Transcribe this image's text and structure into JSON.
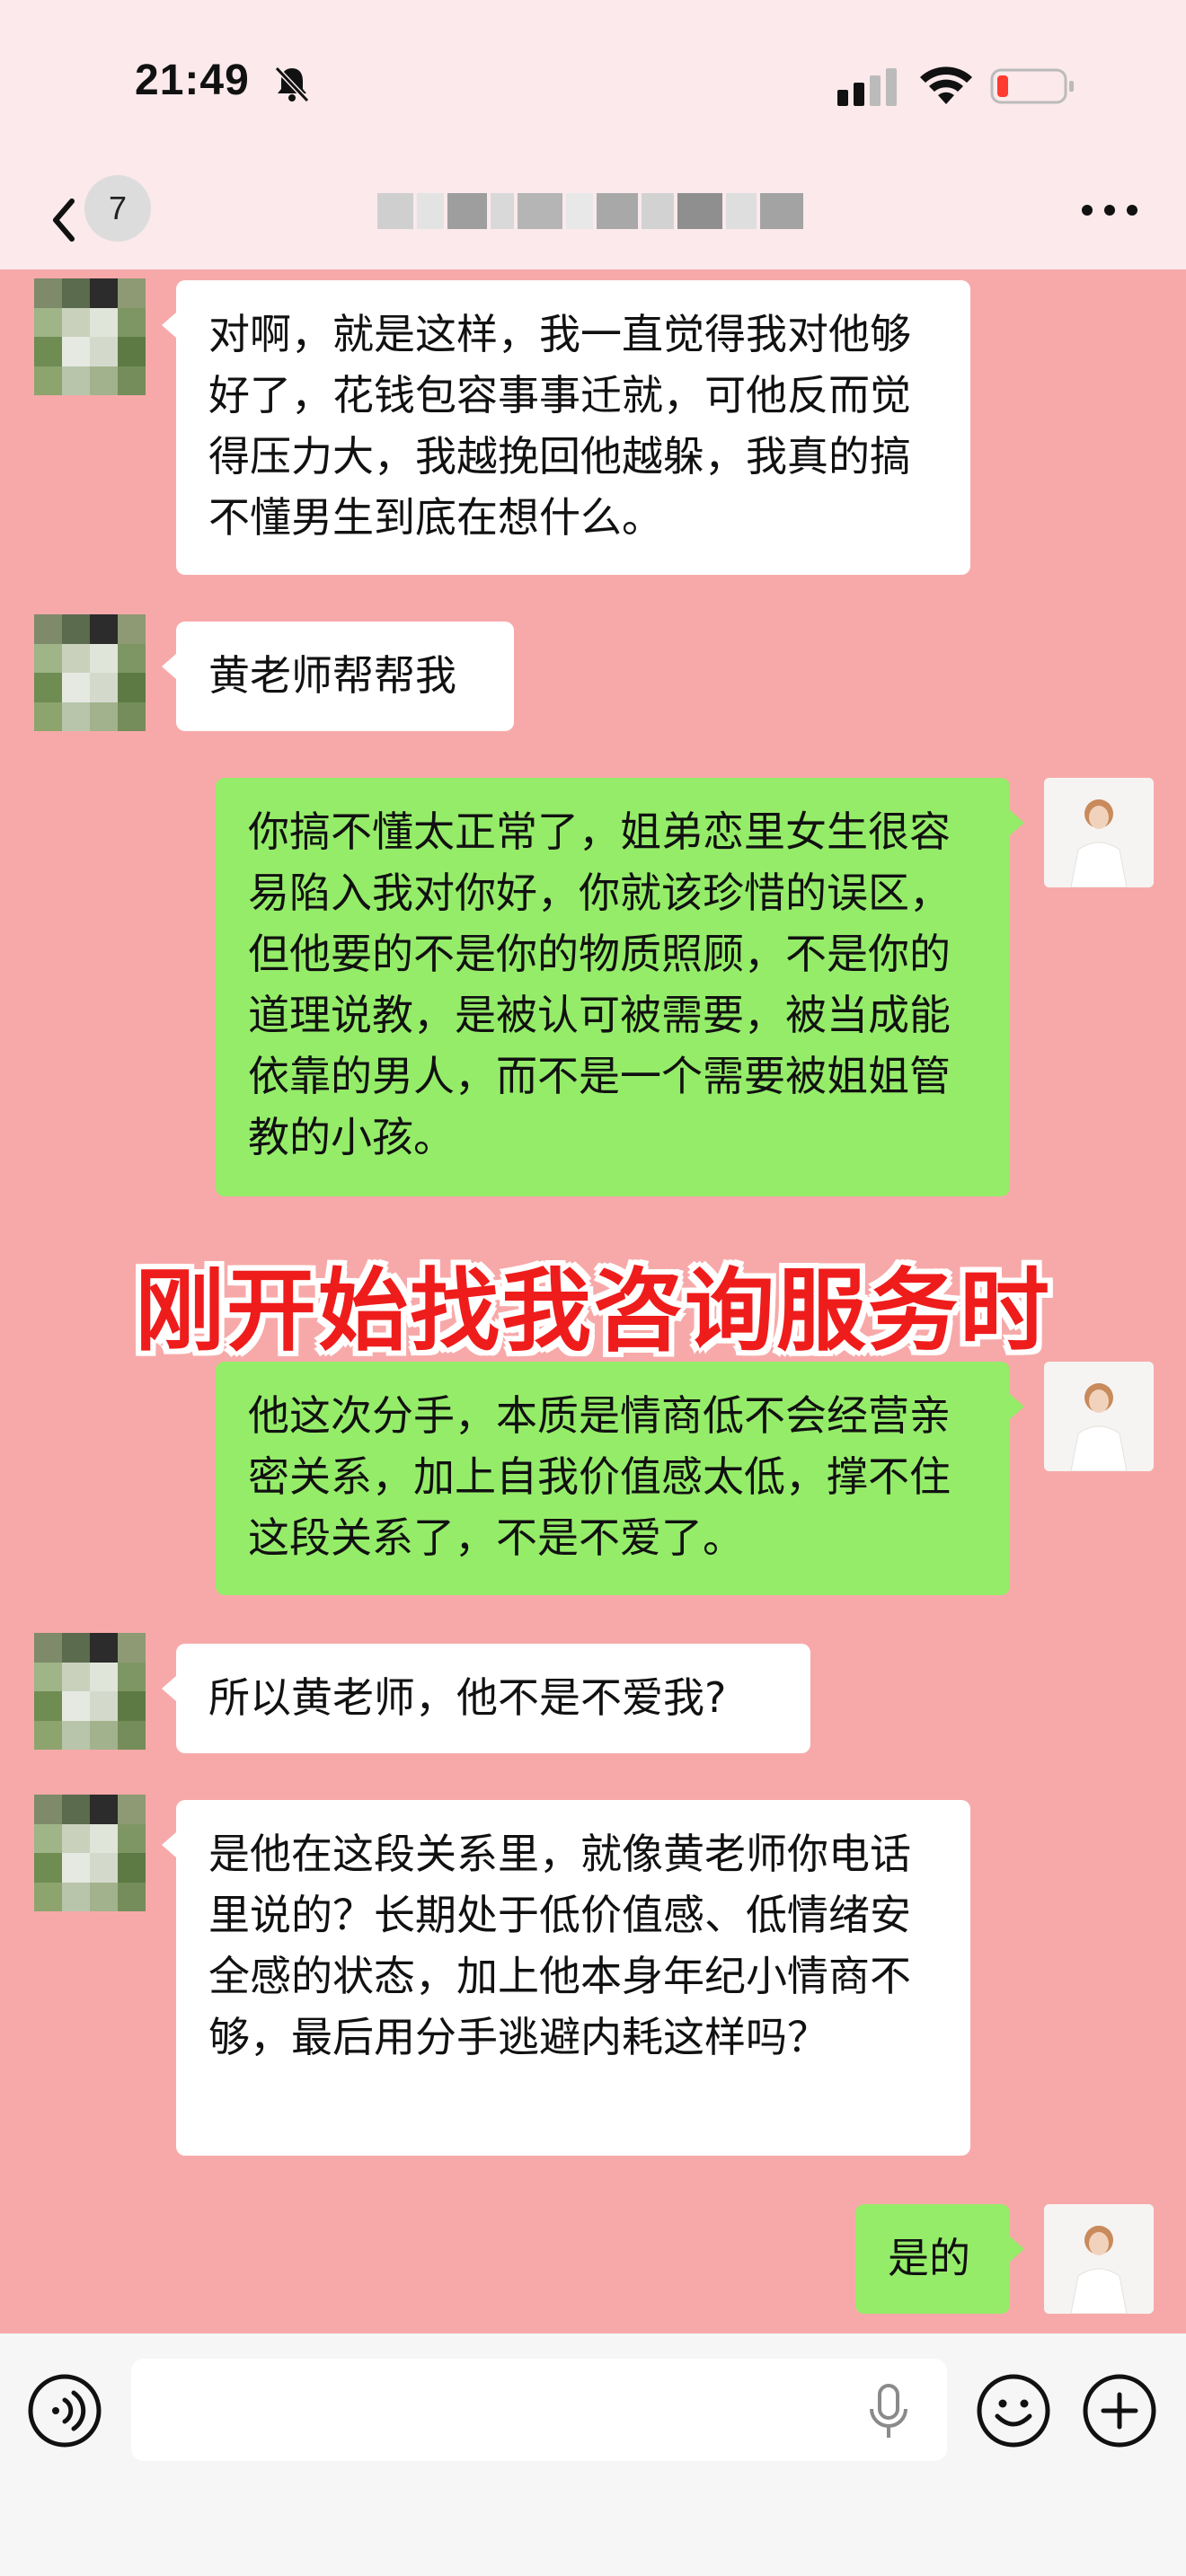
{
  "status_bar": {
    "time": "21:49",
    "icons": [
      "bell-off-icon",
      "signal-icon",
      "wifi-icon",
      "battery-low-icon"
    ],
    "battery_color": "#ff3b30"
  },
  "nav": {
    "back_icon": "chevron-left-icon",
    "unread_count": "7",
    "title_blurred": true,
    "more_icon": "more-horizontal-icon"
  },
  "colors": {
    "chat_background": "#f7a9a9",
    "incoming_bubble": "#ffffff",
    "outgoing_bubble": "#95ec69",
    "overlay_text": "#ef1c1c"
  },
  "messages": [
    {
      "side": "left",
      "text": "对啊，就是这样，我一直觉得我对他够好了，花钱包容事事迁就，可他反而觉得压力大，我越挽回他越躲，我真的搞不懂男生到底在想什么。"
    },
    {
      "side": "left",
      "text": "黄老师帮帮我"
    },
    {
      "side": "right",
      "text": "你搞不懂太正常了，姐弟恋里女生很容易陷入我对你好，你就该珍惜的误区，但他要的不是你的物质照顾，不是你的道理说教，是被认可被需要，被当成能依靠的男人，而不是一个需要被姐姐管教的小孩。"
    },
    {
      "side": "right",
      "text": "他这次分手，本质是情商低不会经营亲密关系，加上自我价值感太低，撑不住这段关系了，不是不爱了。"
    },
    {
      "side": "left",
      "text": "所以黄老师，他不是不爱我?"
    },
    {
      "side": "left",
      "text": "是他在这段关系里，就像黄老师你电话里说的？长期处于低价值感、低情绪安全感的状态，加上他本身年纪小情商不够，最后用分手逃避内耗这样吗？"
    },
    {
      "side": "right",
      "text": "是的"
    }
  ],
  "overlay_caption": "刚开始找我咨询服务时",
  "input_bar": {
    "voice_icon": "voice-icon",
    "mic_icon": "microphone-icon",
    "emoji_icon": "emoji-icon",
    "plus_icon": "plus-icon"
  }
}
